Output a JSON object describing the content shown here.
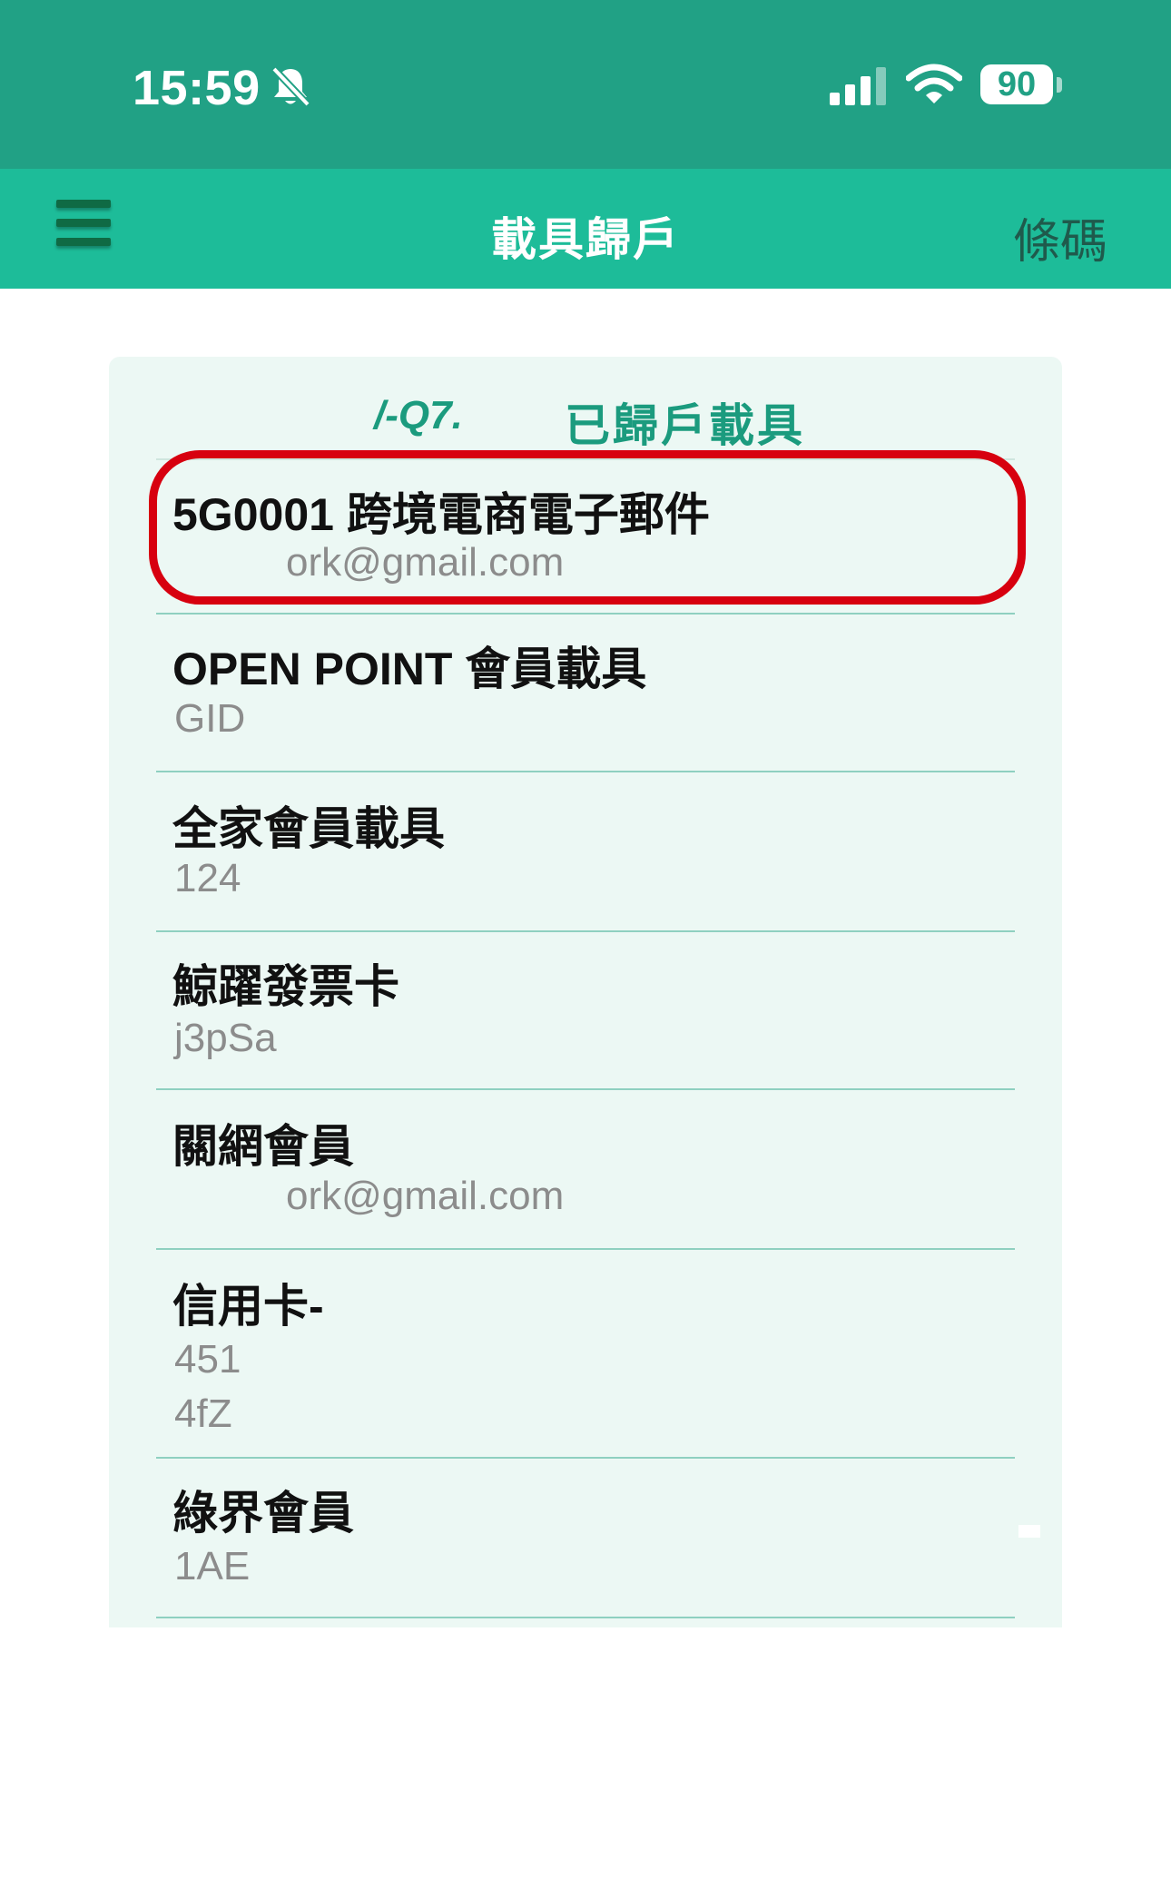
{
  "status_bar": {
    "time": "15:59",
    "battery": "90"
  },
  "nav": {
    "title": "載具歸戶",
    "right_button": "條碼"
  },
  "card": {
    "carrier_id": "/-Q7.",
    "title": "已歸戶載具"
  },
  "items": [
    {
      "title": "5G0001 跨境電商電子郵件",
      "lines": [
        "ork@gmail.com"
      ]
    },
    {
      "title": "OPEN POINT 會員載具",
      "lines": [
        "GID"
      ]
    },
    {
      "title": "全家會員載具",
      "lines": [
        "124"
      ]
    },
    {
      "title": "鯨躍發票卡",
      "lines": [
        "j3pSa"
      ]
    },
    {
      "title": "關網會員",
      "lines": [
        "ork@gmail.com"
      ]
    },
    {
      "title": "信用卡-",
      "lines": [
        "451",
        "4fZ"
      ]
    },
    {
      "title": "綠界會員",
      "lines": [
        "1AE"
      ]
    }
  ],
  "colors": {
    "status_bar": "#21a185",
    "nav_bar": "#1dbc99",
    "card_bg": "#ecf8f4",
    "accent_text": "#1b9b7e",
    "highlight": "#d7000f"
  }
}
